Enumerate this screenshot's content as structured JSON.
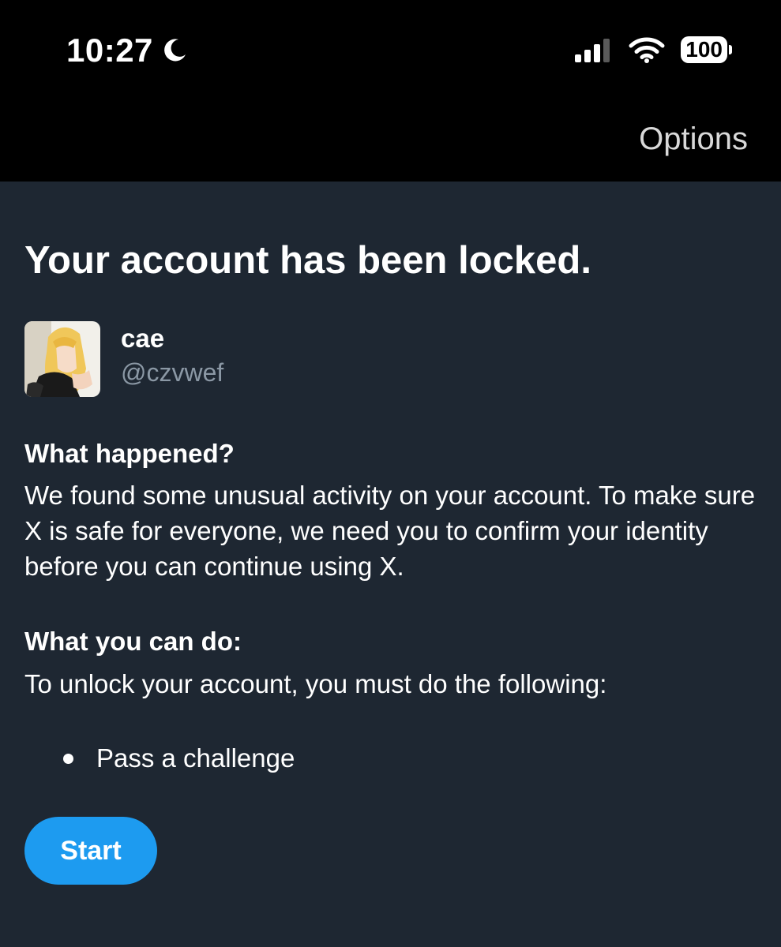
{
  "status_bar": {
    "time": "10:27",
    "battery": "100",
    "icons": [
      "moon-icon",
      "cellular-signal-icon",
      "wifi-icon",
      "battery-icon"
    ]
  },
  "nav": {
    "options_label": "Options"
  },
  "main": {
    "title": "Your account has been locked.",
    "profile": {
      "display_name": "cae",
      "handle": "@czvwef"
    },
    "what_happened": {
      "heading": "What happened?",
      "body": "We found some unusual activity on your account. To make sure X is safe for everyone, we need you to confirm your identity before you can continue using X."
    },
    "what_you_can_do": {
      "heading": "What you can do:",
      "body": "To unlock your account, you must do the following:",
      "steps": [
        "Pass a challenge"
      ]
    },
    "start_button_label": "Start"
  },
  "colors": {
    "background": "#1e2732",
    "bar_background": "#000000",
    "accent": "#1d9bf0",
    "secondary_text": "#8b98a5"
  }
}
